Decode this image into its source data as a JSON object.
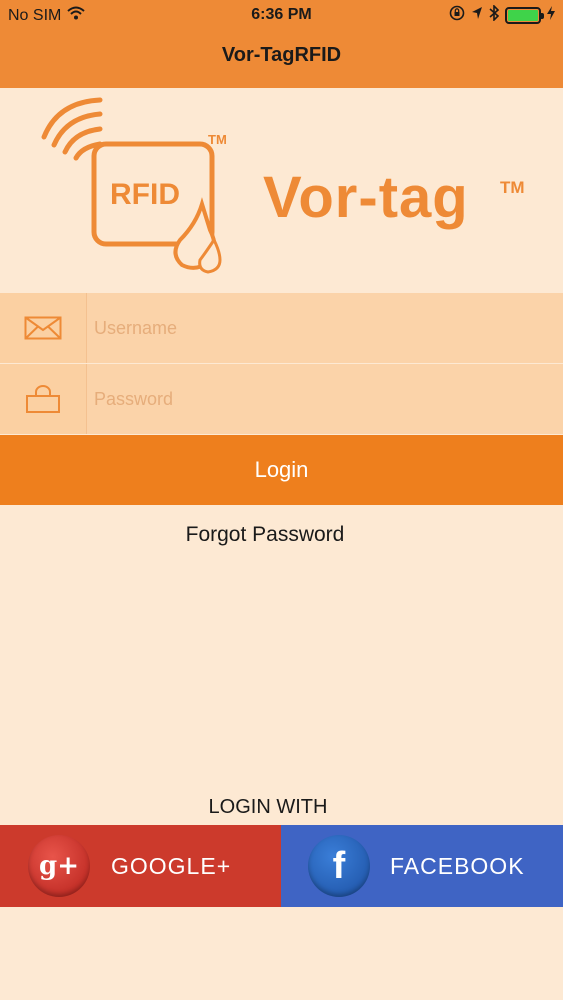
{
  "status_bar": {
    "carrier": "No SIM",
    "time": "6:36 PM",
    "icons": [
      "wifi-icon",
      "lock-rotation-icon",
      "location-icon",
      "bluetooth-icon",
      "battery-icon",
      "charging-icon"
    ]
  },
  "header": {
    "title": "Vor-TagRFID"
  },
  "logo": {
    "badge_text": "RFID",
    "tm": "TM",
    "brand": "Vor-tag",
    "brand_tm": "TM"
  },
  "form": {
    "username": {
      "placeholder": "Username",
      "value": ""
    },
    "password": {
      "placeholder": "Password",
      "value": ""
    },
    "login_label": "Login",
    "forgot_label": "Forgot Password"
  },
  "social": {
    "heading": "LOGIN WITH",
    "google": {
      "icon_text": "g+",
      "label": "GOOGLE+"
    },
    "facebook": {
      "icon_text": "f",
      "label": "FACEBOOK"
    }
  },
  "colors": {
    "accent": "#ee8a36",
    "background": "#fde9d3",
    "google": "#cc3a2c",
    "facebook": "#3f64c4"
  }
}
